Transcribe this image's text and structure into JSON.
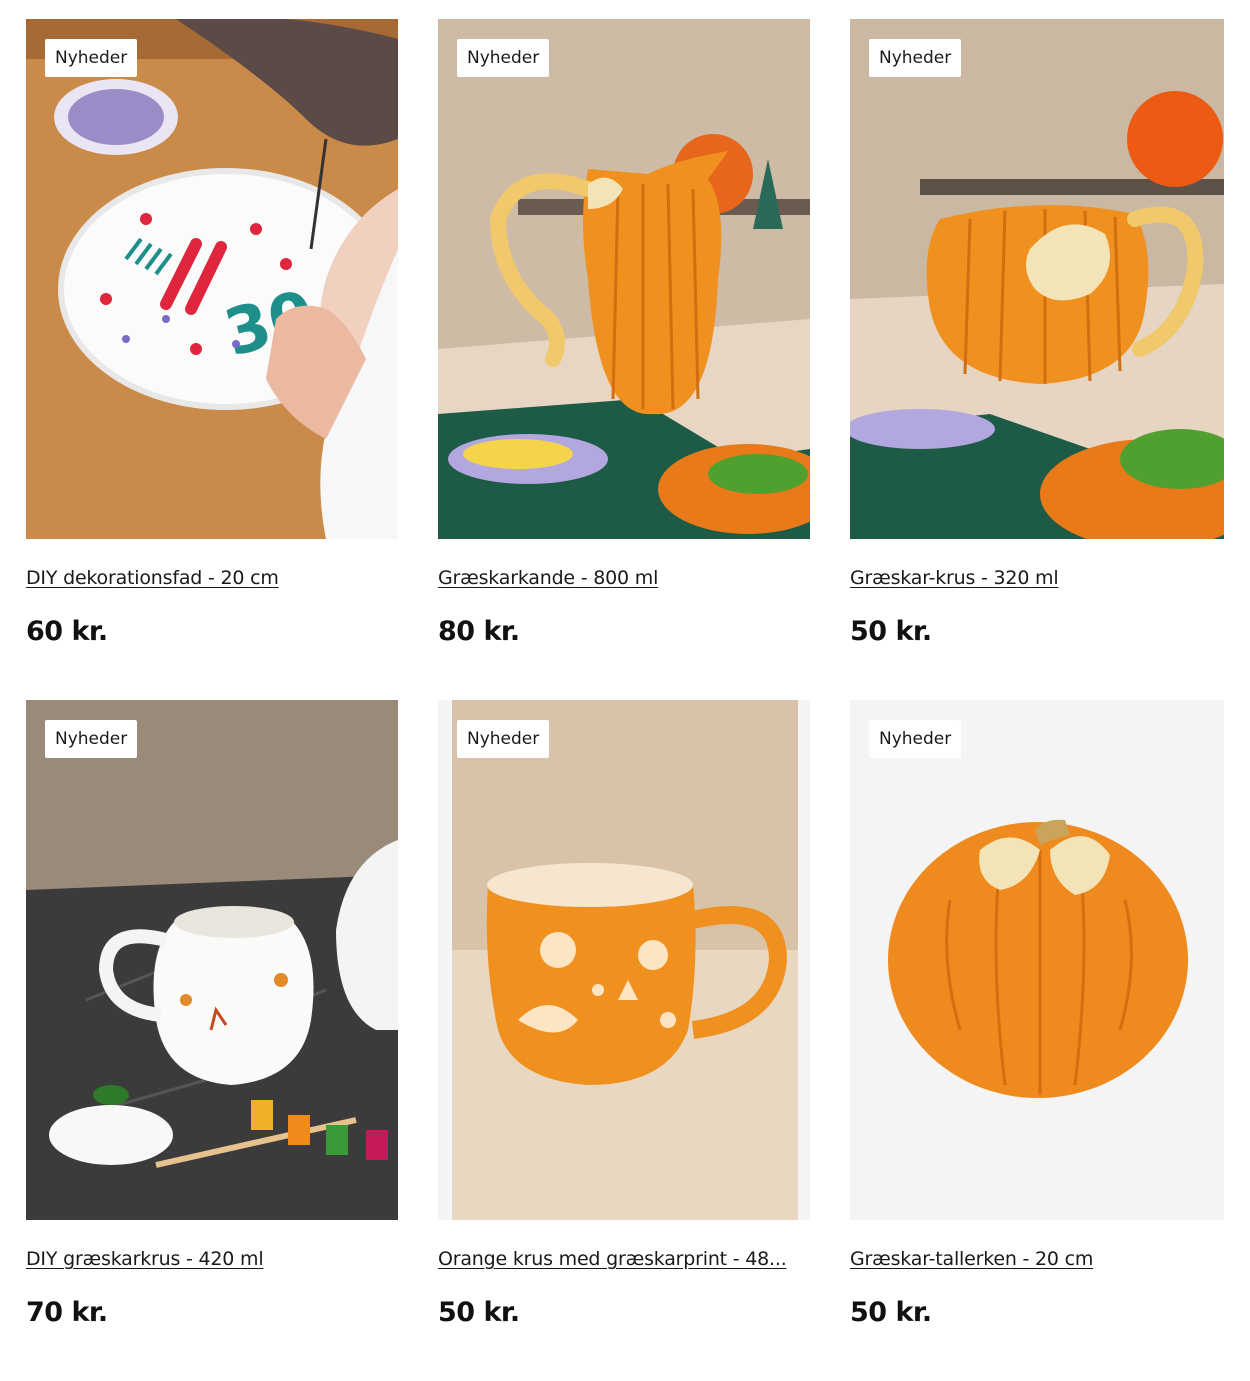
{
  "products": [
    {
      "badge": "Nyheder",
      "title": "DIY dekorationsfad - 20 cm",
      "price": "60 kr.",
      "image_subject": "painted-plate"
    },
    {
      "badge": "Nyheder",
      "title": "Græskarkande - 800 ml",
      "price": "80 kr.",
      "image_subject": "pumpkin-jug"
    },
    {
      "badge": "Nyheder",
      "title": "Græskar-krus - 320 ml",
      "price": "50 kr.",
      "image_subject": "pumpkin-mug"
    },
    {
      "badge": "Nyheder",
      "title": "DIY græskarkrus - 420 ml",
      "price": "70 kr.",
      "image_subject": "diy-pumpkin-mug"
    },
    {
      "badge": "Nyheder",
      "title": "Orange krus med græskarprint - 48...",
      "price": "50 kr.",
      "image_subject": "orange-print-mug"
    },
    {
      "badge": "Nyheder",
      "title": "Græskar-tallerken - 20 cm",
      "price": "50 kr.",
      "image_subject": "pumpkin-plate"
    }
  ],
  "colors": {
    "pumpkin_orange": "#ee8a1c",
    "table_wood": "#c98a4a",
    "tablecloth_green": "#1f5a45",
    "background_grey": "#f4f4f4"
  }
}
